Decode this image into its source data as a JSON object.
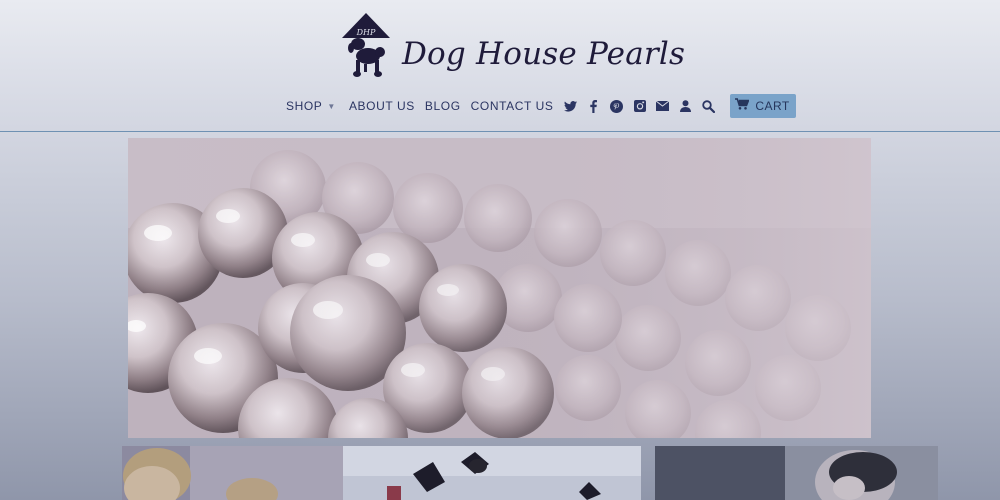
{
  "brand": {
    "name": "Dog House Pearls",
    "monogram": "DHP"
  },
  "nav": {
    "shop_label": "SHOP",
    "about_label": "ABOUT US",
    "blog_label": "BLOG",
    "contact_label": "CONTACT US",
    "cart_label": "CART"
  },
  "icons": [
    "twitter-icon",
    "facebook-icon",
    "pinterest-icon",
    "instagram-icon",
    "mail-icon",
    "user-icon",
    "search-icon",
    "cart-icon",
    "chevron-down-icon"
  ],
  "colors": {
    "brand_text": "#1f1b3a",
    "nav_text": "#2b3562",
    "cart_button": "#7aa3c9",
    "divider": "#6f91b3"
  }
}
